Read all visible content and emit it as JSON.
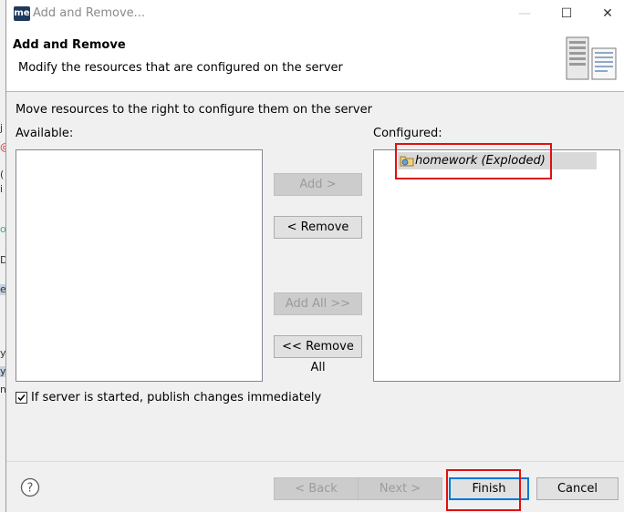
{
  "background_ide": {
    "edge_chars": [
      "j",
      "@",
      "(",
      "i",
      "o",
      "D",
      "e",
      "y",
      "y",
      "n"
    ]
  },
  "window": {
    "app_icon_text": "me",
    "title": "Add and Remove...",
    "minimize": "—",
    "maximize": "☐",
    "close": "✕"
  },
  "header": {
    "title": "Add and Remove",
    "description": "Modify the resources that are configured on the server",
    "image_icon": "server-illustration-icon"
  },
  "body": {
    "intro": "Move resources to the right to configure them on the server",
    "available_label": "Available:",
    "configured_label": "Configured:",
    "available_items": [],
    "configured_items": [
      {
        "label": "homework (Exploded)",
        "icon": "web-module-icon",
        "selected": true
      }
    ]
  },
  "transfer_buttons": {
    "add": "Add >",
    "remove": "< Remove",
    "add_all": "Add All >>",
    "remove_all": "<< Remove All"
  },
  "options": {
    "publish_checkbox_label": "If server is started, publish changes immediately",
    "publish_checked": true
  },
  "footer": {
    "help_icon": "help-icon",
    "back": "< Back",
    "next": "Next >",
    "finish": "Finish",
    "cancel": "Cancel"
  },
  "colors": {
    "highlight_red": "#e01010",
    "default_button_border": "#0078d7",
    "selection_gray": "#d9d9d9"
  }
}
